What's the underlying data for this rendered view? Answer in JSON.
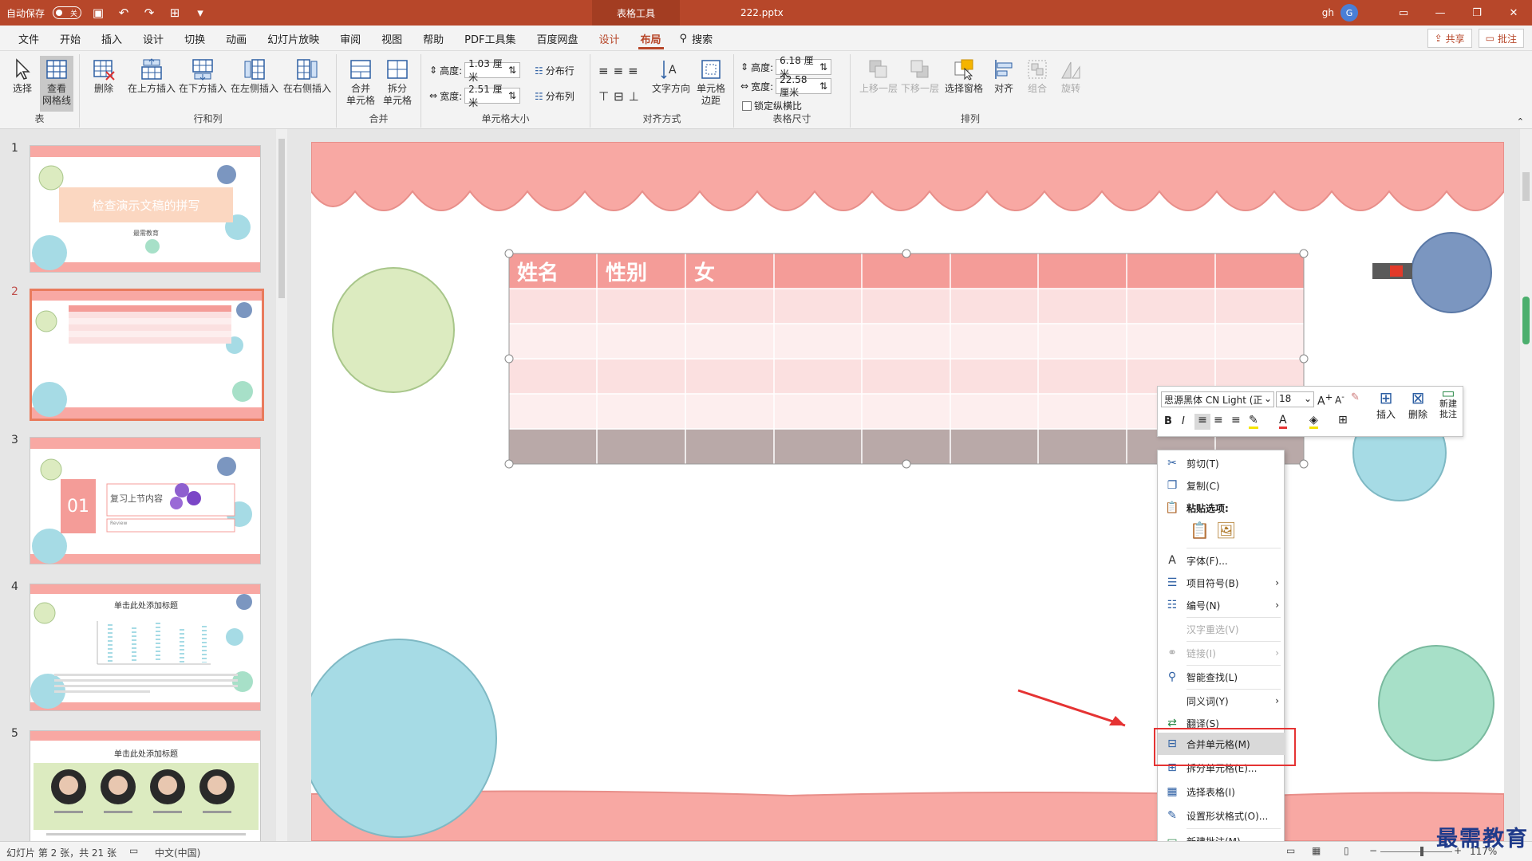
{
  "titlebar": {
    "autosave_label": "自动保存",
    "autosave_state": "关",
    "tool_tab": "表格工具",
    "filename": "222.pptx",
    "user": "gh",
    "avatar_initial": "G",
    "accent": "#b7472a"
  },
  "menu": {
    "tabs": [
      "文件",
      "开始",
      "插入",
      "设计",
      "切换",
      "动画",
      "幻灯片放映",
      "审阅",
      "视图",
      "帮助",
      "PDF工具集",
      "百度网盘",
      "设计",
      "布局"
    ],
    "search": "搜索",
    "share": "共享",
    "comment": "批注"
  },
  "ribbon": {
    "groups": {
      "table": "表",
      "rowscols": "行和列",
      "merge": "合并",
      "cellsize": "单元格大小",
      "align": "对齐方式",
      "tablesize": "表格尺寸",
      "arrange": "排列"
    },
    "select": "选择",
    "view_grid": "查看\n网格线",
    "delete": "删除",
    "insert_above": "在上方插入",
    "insert_below": "在下方插入",
    "insert_left": "在左侧插入",
    "insert_right": "在右侧插入",
    "merge_cells": "合并\n单元格",
    "split_cells": "拆分\n单元格",
    "height_label": "高度:",
    "height_value": "1.03 厘米",
    "width_label": "宽度:",
    "width_value": "2.51 厘米",
    "distribute_rows": "分布行",
    "distribute_cols": "分布列",
    "text_direction": "文字方向",
    "cell_margins": "单元格\n边距",
    "table_height_label": "高度:",
    "table_height_value": "6.18 厘米",
    "table_width_label": "宽度:",
    "table_width_value": "22.58 厘米",
    "lock_ratio": "锁定纵横比",
    "bring_forward": "上移一层",
    "send_backward": "下移一层",
    "selection_pane": "选择窗格",
    "align_btn": "对齐",
    "group_btn": "组合",
    "rotate_btn": "旋转"
  },
  "slides_panel": {
    "numbers": [
      "1",
      "2",
      "3",
      "4",
      "5"
    ],
    "slide1_title": "检查演示文稿的拼写",
    "slide1_sub": "最需教育",
    "slide3_num": "01",
    "slide3_title": "复习上节内容",
    "slide3_sub": "Review",
    "slide4_title": "单击此处添加标题",
    "slide5_title": "单击此处添加标题"
  },
  "slide": {
    "table_headers": [
      "姓名",
      "性别",
      "女"
    ],
    "colors": {
      "header": "#f49c98",
      "row_a": "#fbe0e0",
      "row_b": "#fdeeee",
      "selected": "#b9a9a8",
      "scallop": "#f8a8a3"
    }
  },
  "mini_toolbar": {
    "font_name": "思源黑体 CN Light (正",
    "font_size": "18",
    "insert": "插入",
    "delete": "删除",
    "new_comment": "新建\n批注"
  },
  "context_menu": {
    "cut": "剪切(T)",
    "copy": "复制(C)",
    "paste_options": "粘贴选项:",
    "font": "字体(F)...",
    "bullets": "项目符号(B)",
    "numbering": "编号(N)",
    "reconvert": "汉字重选(V)",
    "link": "链接(I)",
    "smart_lookup": "智能查找(L)",
    "synonyms": "同义词(Y)",
    "translate": "翻译(S)",
    "merge_cells": "合并单元格(M)",
    "split_cells": "拆分单元格(E)...",
    "select_table": "选择表格(I)",
    "format_shape": "设置形状格式(O)...",
    "new_comment": "新建批注(M)"
  },
  "status": {
    "slide_info": "幻灯片 第 2 张，共 21 张",
    "language": "中文(中国)",
    "zoom": "117%"
  },
  "watermark": "最需教育"
}
